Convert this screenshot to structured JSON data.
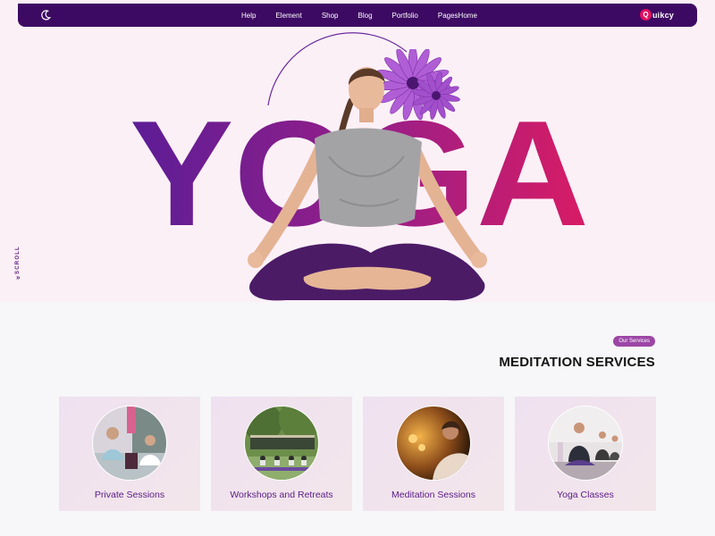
{
  "nav": {
    "items": [
      "Help",
      "Element",
      "Shop",
      "Blog",
      "Portfolio",
      "PagesHome"
    ],
    "brand_badge": "Q",
    "brand_text": "uikcy"
  },
  "hero": {
    "title": "YOGA",
    "scroll_label": "SCROLL",
    "scroll_arrow": "»"
  },
  "services": {
    "tag": "Our Services",
    "title": "MEDITATION SERVICES",
    "cards": [
      {
        "label": "Private Sessions"
      },
      {
        "label": "Workshops and Retreats"
      },
      {
        "label": "Meditation Sessions"
      },
      {
        "label": "Yoga Classes"
      }
    ]
  },
  "colors": {
    "nav_bg": "#3d0a63",
    "hero_bg": "#fcf0f7",
    "gradient_start": "#5c1d96",
    "gradient_end": "#d91b64",
    "accent_tag": "#9c46a6",
    "card_label": "#5b1a85"
  }
}
